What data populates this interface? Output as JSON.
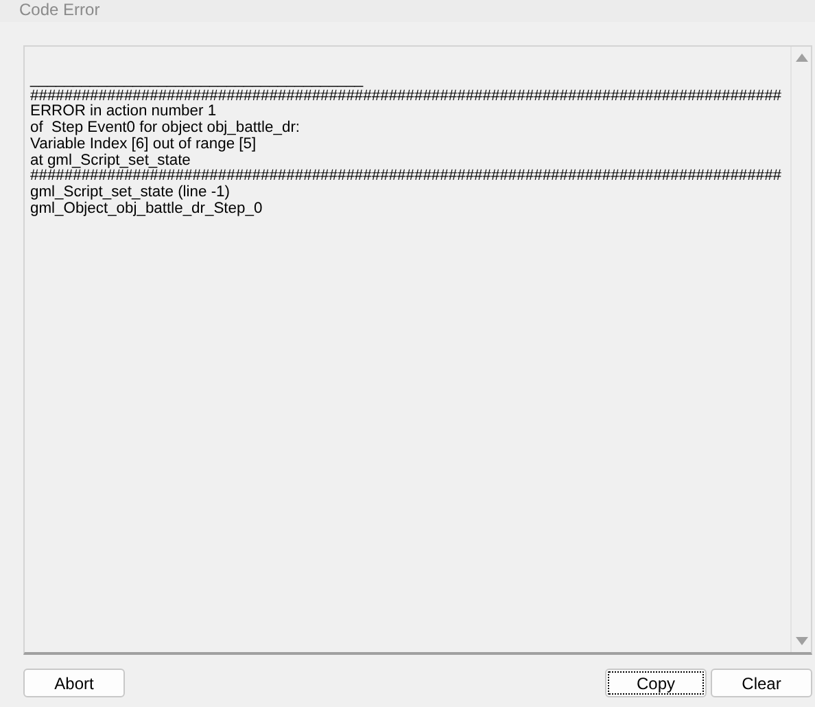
{
  "window": {
    "title": "Code Error"
  },
  "log_lines": [
    "_______________________________________",
    "########################################################################################",
    "ERROR in action number 1",
    "of  Step Event0 for object obj_battle_dr:",
    "Variable Index [6] out of range [5]",
    "at gml_Script_set_state",
    "########################################################################################",
    "gml_Script_set_state (line -1)",
    "gml_Object_obj_battle_dr_Step_0"
  ],
  "left_buttons": [
    {
      "label": "Abort",
      "focused": false
    }
  ],
  "right_buttons": [
    {
      "label": "Copy",
      "focused": true
    },
    {
      "label": "Clear",
      "focused": false
    }
  ]
}
